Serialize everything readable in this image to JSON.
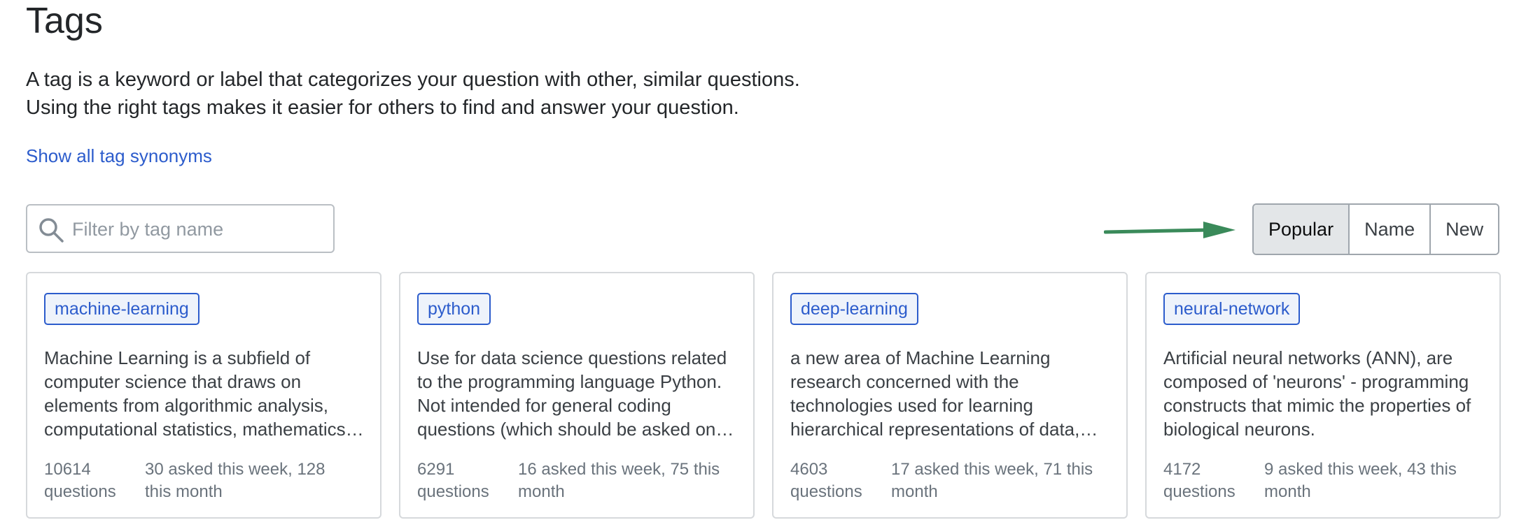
{
  "page": {
    "title": "Tags",
    "intro_line1": "A tag is a keyword or label that categorizes your question with other, similar questions.",
    "intro_line2": "Using the right tags makes it easier for others to find and answer your question.",
    "synonyms_link": "Show all tag synonyms"
  },
  "filter": {
    "placeholder": "Filter by tag name",
    "value": "",
    "icon": "search-icon"
  },
  "sort": {
    "options": [
      "Popular",
      "Name",
      "New"
    ],
    "selected": "Popular"
  },
  "annotation": {
    "arrow_color": "#3a8a5a"
  },
  "colors": {
    "link": "#2c5ccc",
    "tag_bg": "#eef3fb",
    "active_sort_bg": "#e3e6e8"
  },
  "tags": [
    {
      "name": "machine-learning",
      "excerpt": "Machine Learning is a subfield of computer science that draws on elements from algorithmic analysis, computational statistics, mathematics, optimization, etc.",
      "count": "10614 questions",
      "asked": "30 asked this week, 128 this month"
    },
    {
      "name": "python",
      "excerpt": "Use for data science questions related to the programming language Python. Not intended for general coding questions (which should be asked on Stack Overflow).",
      "count": "6291 questions",
      "asked": "16 asked this week, 75 this month"
    },
    {
      "name": "deep-learning",
      "excerpt": "a new area of Machine Learning research concerned with the technologies used for learning hierarchical representations of data, mainly done with deep neural networks.",
      "count": "4603 questions",
      "asked": "17 asked this week, 71 this month"
    },
    {
      "name": "neural-network",
      "excerpt": "Artificial neural networks (ANN), are composed of 'neurons' - programming constructs that mimic the properties of biological neurons.",
      "count": "4172 questions",
      "asked": "9 asked this week, 43 this month"
    }
  ]
}
